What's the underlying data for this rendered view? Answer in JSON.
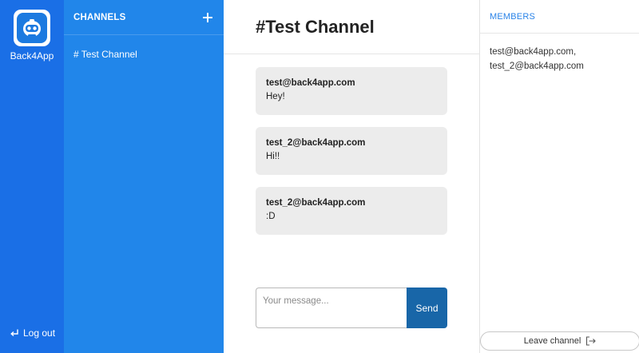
{
  "brand": {
    "name": "Back4App",
    "logo_icon": "robot-logo-icon"
  },
  "sidebar": {
    "logout_label": "Log out",
    "logout_icon": "return-arrow-icon"
  },
  "channels": {
    "title": "CHANNELS",
    "add_icon": "plus-icon",
    "items": [
      {
        "label": "# Test Channel"
      }
    ]
  },
  "chat": {
    "channel_title": "#Test Channel",
    "messages": [
      {
        "author": "test@back4app.com",
        "text": "Hey!"
      },
      {
        "author": "test_2@back4app.com",
        "text": "Hi!!"
      },
      {
        "author": "test_2@back4app.com",
        "text": ":D"
      }
    ],
    "input_placeholder": "Your message...",
    "input_value": "",
    "send_label": "Send"
  },
  "members": {
    "title": "MEMBERS",
    "list_text_line1": "test@back4app.com,",
    "list_text_line2": "test_2@back4app.com",
    "leave_label": "Leave channel",
    "leave_icon": "exit-icon"
  },
  "colors": {
    "rail": "#1a6fe6",
    "channels_bg": "#2186ea",
    "send_button": "#1866a8",
    "members_title": "#2a83e8",
    "message_bg": "#ececec"
  }
}
